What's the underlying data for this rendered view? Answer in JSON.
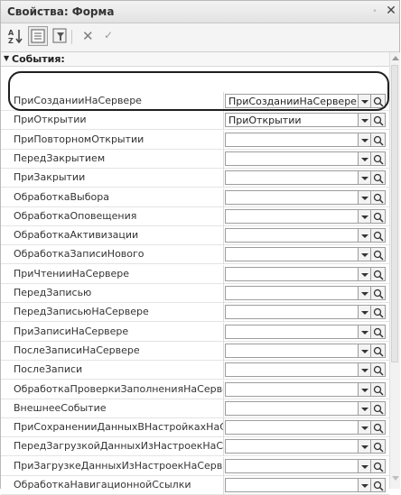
{
  "window": {
    "title": "Свойства: Форма",
    "pin_glyph": "•",
    "close_glyph": "✕"
  },
  "toolbar": {
    "cancel_glyph": "✕",
    "confirm_glyph": "✓"
  },
  "group": {
    "label": "События:"
  },
  "events": [
    {
      "name": "ПриСозданииНаСервере",
      "value": "ПриСозданииНаСервере"
    },
    {
      "name": "ПриОткрытии",
      "value": "ПриОткрытии"
    },
    {
      "name": "ПриПовторномОткрытии",
      "value": ""
    },
    {
      "name": "ПередЗакрытием",
      "value": ""
    },
    {
      "name": "ПриЗакрытии",
      "value": ""
    },
    {
      "name": "ОбработкаВыбора",
      "value": ""
    },
    {
      "name": "ОбработкаОповещения",
      "value": ""
    },
    {
      "name": "ОбработкаАктивизации",
      "value": ""
    },
    {
      "name": "ОбработкаЗаписиНового",
      "value": ""
    },
    {
      "name": "ПриЧтенииНаСервере",
      "value": ""
    },
    {
      "name": "ПередЗаписью",
      "value": ""
    },
    {
      "name": "ПередЗаписьюНаСервере",
      "value": ""
    },
    {
      "name": "ПриЗаписиНаСервере",
      "value": ""
    },
    {
      "name": "ПослеЗаписиНаСервере",
      "value": ""
    },
    {
      "name": "ПослеЗаписи",
      "value": ""
    },
    {
      "name": "ОбработкаПроверкиЗаполненияНаСерве",
      "value": ""
    },
    {
      "name": "ВнешнееСобытие",
      "value": ""
    },
    {
      "name": "ПриСохраненииДанныхВНастройкахНаС",
      "value": ""
    },
    {
      "name": "ПередЗагрузкойДанныхИзНастроекНаС",
      "value": ""
    },
    {
      "name": "ПриЗагрузкеДанныхИзНастроекНаСерв",
      "value": ""
    },
    {
      "name": "ОбработкаНавигационнойСсылки",
      "value": ""
    }
  ]
}
